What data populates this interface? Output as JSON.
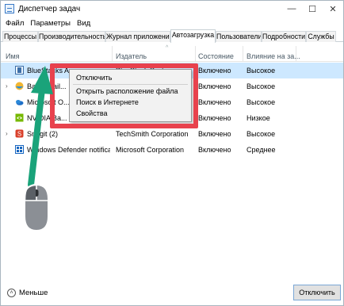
{
  "window": {
    "title": "Диспетчер задач"
  },
  "menu": [
    "Файл",
    "Параметры",
    "Вид"
  ],
  "tabs": [
    {
      "label": "Процессы",
      "active": false
    },
    {
      "label": "Производительность",
      "active": false
    },
    {
      "label": "Журнал приложений",
      "active": false
    },
    {
      "label": "Автозагрузка",
      "active": true
    },
    {
      "label": "Пользователи",
      "active": false
    },
    {
      "label": "Подробности",
      "active": false
    },
    {
      "label": "Службы",
      "active": false
    }
  ],
  "columns": {
    "name": "Имя",
    "publisher": "Издатель",
    "status": "Состояние",
    "impact": "Влияние на за..."
  },
  "rows": [
    {
      "name": "BlueStacks Ag...",
      "publisher": "BlueStack Systems",
      "status": "Включено",
      "impact": "Высокое",
      "expandable": false,
      "selected": true,
      "icon": "bluestacks-icon"
    },
    {
      "name": "Bandi Mail...",
      "publisher": "",
      "status": "Включено",
      "impact": "Высокое",
      "expandable": true,
      "selected": false,
      "icon": "mail-icon"
    },
    {
      "name": "Microsoft O...",
      "publisher": "",
      "status": "Включено",
      "impact": "Высокое",
      "expandable": false,
      "selected": false,
      "icon": "onedrive-icon"
    },
    {
      "name": "NVIDIA Ba...",
      "publisher": "",
      "status": "Включено",
      "impact": "Низкое",
      "expandable": false,
      "selected": false,
      "icon": "nvidia-icon"
    },
    {
      "name": "Snagit (2)",
      "publisher": "TechSmith Corporation",
      "status": "Включено",
      "impact": "Высокое",
      "expandable": true,
      "selected": false,
      "icon": "snagit-icon"
    },
    {
      "name": "Windows Defender notificati...",
      "publisher": "Microsoft Corporation",
      "status": "Включено",
      "impact": "Среднее",
      "expandable": false,
      "selected": false,
      "icon": "defender-icon"
    }
  ],
  "context_menu": {
    "disable": "Отключить",
    "open_location": "Открыть расположение файла",
    "search_online": "Поиск в Интернете",
    "properties": "Свойства"
  },
  "footer": {
    "less": "Меньше",
    "disable_button": "Отключить"
  },
  "colors": {
    "highlight_frame": "#e8424d",
    "arrow": "#1aa37a",
    "selected_row": "#cde8ff"
  }
}
